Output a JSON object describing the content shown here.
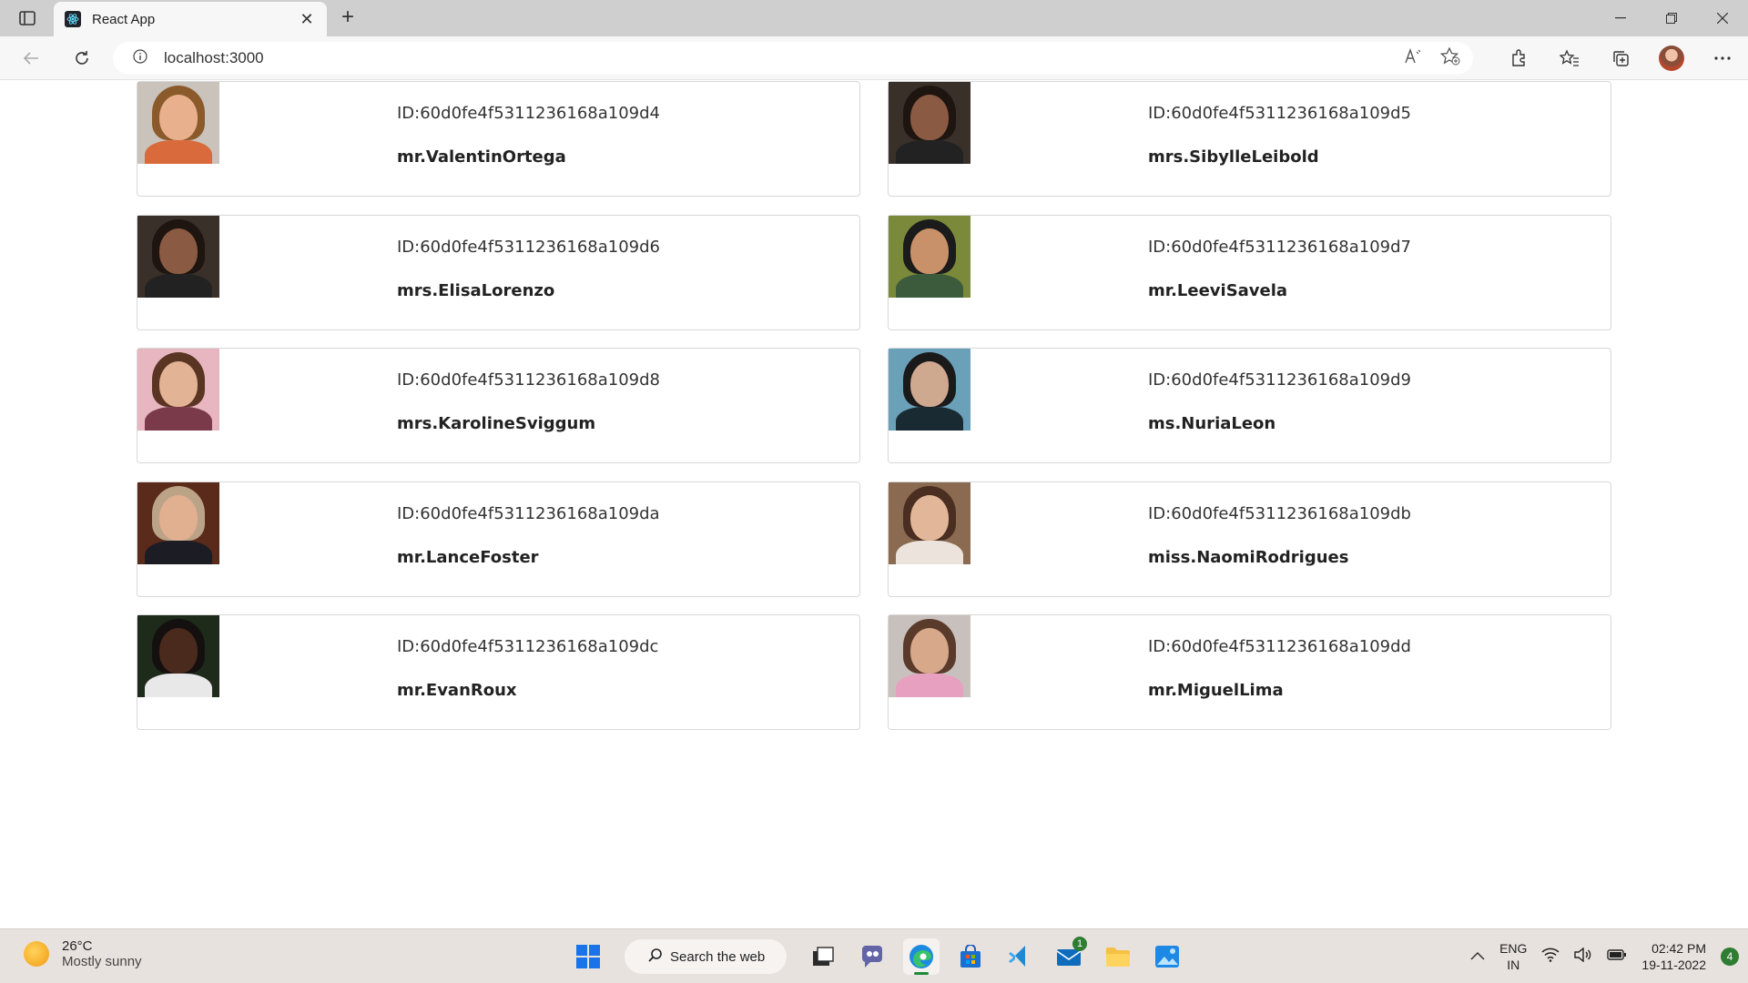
{
  "browser": {
    "tab_title": "React App",
    "url": "localhost:3000"
  },
  "users": [
    {
      "id": "ID:60d0fe4f5311236168a109d4",
      "name": "mr.ValentinOrtega",
      "skin": "#e9b08e",
      "hair": "#8a5a2b",
      "body": "#d96a3c",
      "bg": "#c9c3bc"
    },
    {
      "id": "ID:60d0fe4f5311236168a109d5",
      "name": "mrs.SibylleLeibold",
      "skin": "#8a5a42",
      "hair": "#1e1410",
      "body": "#222222",
      "bg": "#3a302a"
    },
    {
      "id": "ID:60d0fe4f5311236168a109d6",
      "name": "mrs.ElisaLorenzo",
      "skin": "#8a5a42",
      "hair": "#1e1410",
      "body": "#222222",
      "bg": "#3a302a"
    },
    {
      "id": "ID:60d0fe4f5311236168a109d7",
      "name": "mr.LeeviSavela",
      "skin": "#c8916a",
      "hair": "#1b1b1b",
      "body": "#3c5a3c",
      "bg": "#7a8a3a"
    },
    {
      "id": "ID:60d0fe4f5311236168a109d8",
      "name": "mrs.KarolineSviggum",
      "skin": "#e2b394",
      "hair": "#5a3524",
      "body": "#7a3a4a",
      "bg": "#e8b6c0"
    },
    {
      "id": "ID:60d0fe4f5311236168a109d9",
      "name": "ms.NuriaLeon",
      "skin": "#cfa890",
      "hair": "#1a1a1a",
      "body": "#1a2a33",
      "bg": "#6aa0b8"
    },
    {
      "id": "ID:60d0fe4f5311236168a109da",
      "name": "mr.LanceFoster",
      "skin": "#e0b090",
      "hair": "#bba388",
      "body": "#1c1c24",
      "bg": "#5a2a1a"
    },
    {
      "id": "ID:60d0fe4f5311236168a109db",
      "name": "miss.NaomiRodrigues",
      "skin": "#e2b699",
      "hair": "#4a2e22",
      "body": "#ece4dc",
      "bg": "#8a6a50"
    },
    {
      "id": "ID:60d0fe4f5311236168a109dc",
      "name": "mr.EvanRoux",
      "skin": "#4a2a1c",
      "hair": "#141010",
      "body": "#e8e8e8",
      "bg": "#1e2a1a"
    },
    {
      "id": "ID:60d0fe4f5311236168a109dd",
      "name": "mr.MiguelLima",
      "skin": "#d8a88a",
      "hair": "#5a3a2a",
      "body": "#e8a0c0",
      "bg": "#c8c0bc"
    }
  ],
  "taskbar": {
    "temperature": "26°C",
    "weather": "Mostly sunny",
    "search_label": "Search the web",
    "mail_badge": "1",
    "lang_top": "ENG",
    "lang_bottom": "IN",
    "time": "02:42 PM",
    "date": "19-11-2022",
    "notification_count": "4"
  }
}
